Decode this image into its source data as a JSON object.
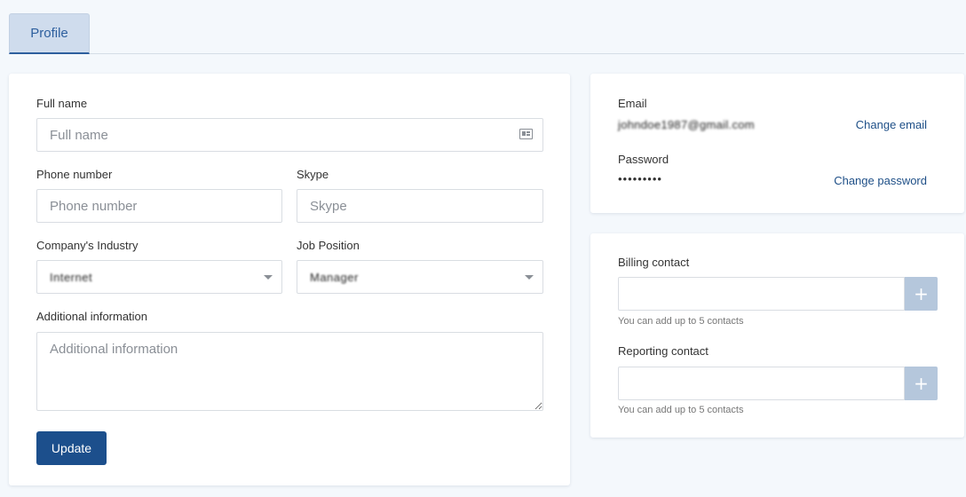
{
  "tabs": [
    {
      "label": "Profile",
      "active": true
    }
  ],
  "profile": {
    "full_name": {
      "label": "Full name",
      "placeholder": "Full name",
      "value": ""
    },
    "phone": {
      "label": "Phone number",
      "placeholder": "Phone number",
      "value": ""
    },
    "skype": {
      "label": "Skype",
      "placeholder": "Skype",
      "value": ""
    },
    "industry": {
      "label": "Company's Industry",
      "value": "Internet"
    },
    "job_position": {
      "label": "Job Position",
      "value": "Manager"
    },
    "additional": {
      "label": "Additional information",
      "placeholder": "Additional information",
      "value": ""
    },
    "update_label": "Update"
  },
  "account": {
    "email_label": "Email",
    "email_value": "johndoe1987@gmail.com",
    "change_email": "Change email",
    "password_label": "Password",
    "password_value": "•••••••••",
    "change_password": "Change password"
  },
  "contacts": {
    "billing_label": "Billing contact",
    "billing_hint": "You can add up to 5 contacts",
    "reporting_label": "Reporting contact",
    "reporting_hint": "You can add up to 5 contacts",
    "add_symbol": "+"
  },
  "colors": {
    "primary": "#1c4f8c",
    "link": "#1e4f87",
    "tab_active_bg": "#cfdced",
    "add_button": "#b5c7dc",
    "page_bg": "#f4f8fc"
  },
  "icons": {
    "full_name": "id-card-icon",
    "select": "chevron-down-icon",
    "add": "plus-icon"
  }
}
